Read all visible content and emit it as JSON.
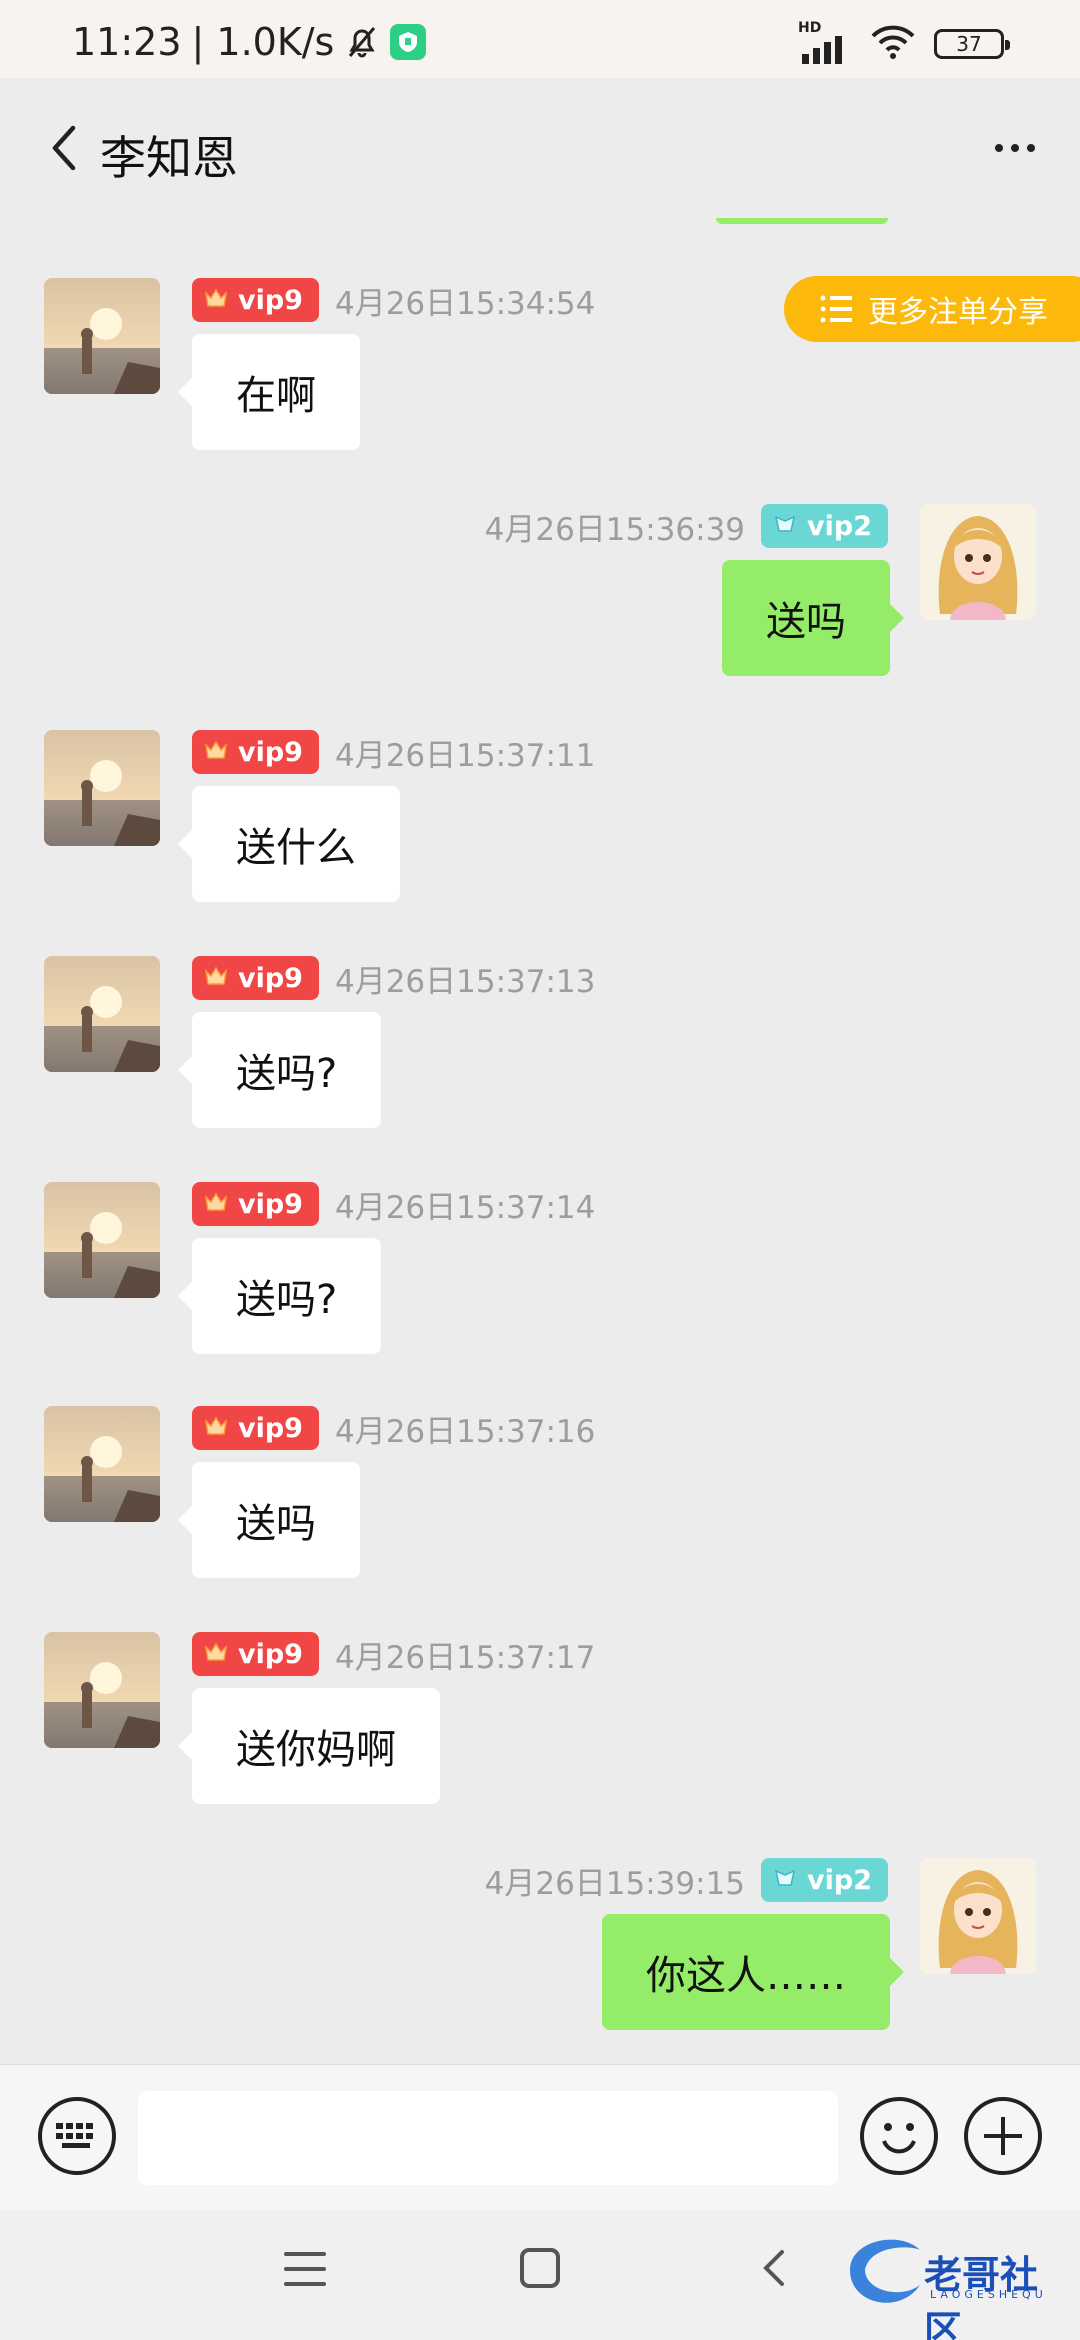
{
  "status_bar": {
    "time": "11:23",
    "speed": "| 1.0K/s",
    "network": "HD",
    "battery": "37"
  },
  "header": {
    "title": "李知恩"
  },
  "share_button": {
    "label": "更多注单分享"
  },
  "messages": [
    {
      "side": "left",
      "vip": "vip9",
      "time": "4月26日15:34:54",
      "text": "在啊"
    },
    {
      "side": "right",
      "vip": "vip2",
      "time": "4月26日15:36:39",
      "text": "送吗"
    },
    {
      "side": "left",
      "vip": "vip9",
      "time": "4月26日15:37:11",
      "text": "送什么"
    },
    {
      "side": "left",
      "vip": "vip9",
      "time": "4月26日15:37:13",
      "text": "送吗?"
    },
    {
      "side": "left",
      "vip": "vip9",
      "time": "4月26日15:37:14",
      "text": "送吗?"
    },
    {
      "side": "left",
      "vip": "vip9",
      "time": "4月26日15:37:16",
      "text": "送吗"
    },
    {
      "side": "left",
      "vip": "vip9",
      "time": "4月26日15:37:17",
      "text": "送你妈啊"
    },
    {
      "side": "right",
      "vip": "vip2",
      "time": "4月26日15:39:15",
      "text": "你这人……"
    }
  ],
  "input": {
    "value": "",
    "placeholder": ""
  },
  "watermark": {
    "title": "老哥社区",
    "subtitle": "LAOGESHEQU"
  },
  "colors": {
    "self_bubble": "#95ec69",
    "other_bubble": "#ffffff",
    "vip9_badge": "#f04646",
    "vip2_badge": "#6bd7d5",
    "share_button": "#fcb90b",
    "background": "#ececec"
  },
  "icons": [
    "back-arrow-icon",
    "more-dots-icon",
    "list-icon",
    "crown-icon",
    "keyboard-icon",
    "emoji-icon",
    "plus-icon",
    "bell-off-icon",
    "wifi-icon"
  ]
}
